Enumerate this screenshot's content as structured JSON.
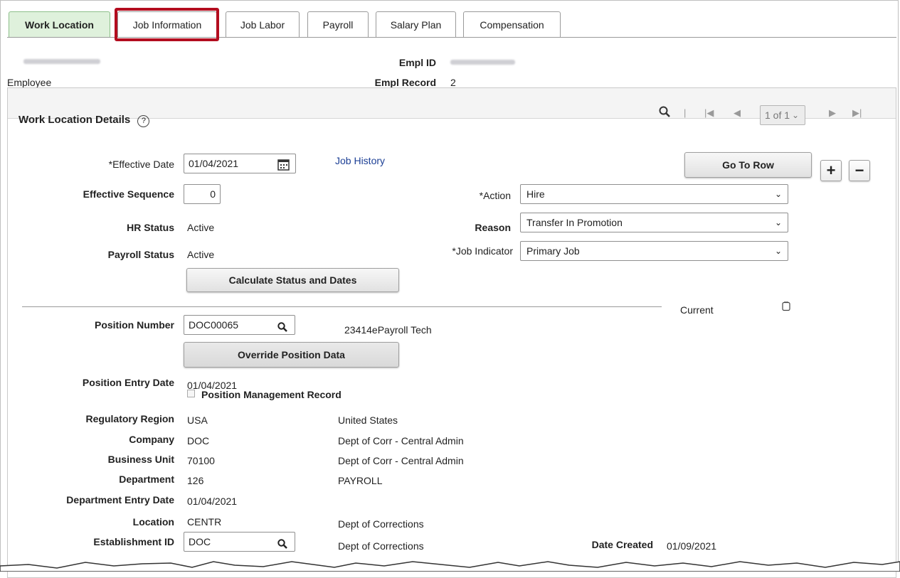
{
  "tabs": [
    {
      "label": "Work Location",
      "active": true
    },
    {
      "label": "Job Information",
      "active": false
    },
    {
      "label": "Job Labor",
      "active": false
    },
    {
      "label": "Payroll",
      "active": false
    },
    {
      "label": "Salary Plan",
      "active": false
    },
    {
      "label": "Compensation",
      "active": false
    }
  ],
  "header": {
    "employee_label": "Employee",
    "empl_id_label": "Empl ID",
    "empl_record_label": "Empl Record",
    "empl_record_value": "2"
  },
  "section": {
    "title": "Work Location Details",
    "pager": "1 of 1"
  },
  "form": {
    "effective_date_label": "*Effective Date",
    "effective_date": "01/04/2021",
    "job_history_link": "Job History",
    "go_to_row": "Go To Row",
    "effective_sequence_label": "Effective Sequence",
    "effective_sequence": "0",
    "action_label": "*Action",
    "action_value": "Hire",
    "hr_status_label": "HR Status",
    "hr_status": "Active",
    "reason_label": "Reason",
    "reason_value": "Transfer In Promotion",
    "payroll_status_label": "Payroll Status",
    "payroll_status": "Active",
    "job_indicator_label": "*Job Indicator",
    "job_indicator_value": "Primary Job",
    "calc_button": "Calculate Status and Dates",
    "current_label": "Current",
    "position_number_label": "Position Number",
    "position_number": "DOC00065",
    "position_desc": "23414ePayroll Tech",
    "override_button": "Override Position Data",
    "position_entry_date_label": "Position Entry Date",
    "position_entry_date": "01/04/2021",
    "position_mgmt_label": "Position Management Record",
    "regulatory_region_label": "Regulatory Region",
    "regulatory_region": "USA",
    "regulatory_region_desc": "United States",
    "company_label": "Company",
    "company": "DOC",
    "company_desc": "Dept of Corr - Central Admin",
    "business_unit_label": "Business Unit",
    "business_unit": "70100",
    "business_unit_desc": "Dept of Corr - Central Admin",
    "department_label": "Department",
    "department": "126",
    "department_desc": "PAYROLL",
    "dept_entry_date_label": "Department Entry Date",
    "dept_entry_date": "01/04/2021",
    "location_label": "Location",
    "location": "CENTR",
    "location_desc": "Dept of Corrections",
    "establishment_label": "Establishment ID",
    "establishment": "DOC",
    "establishment_desc": "Dept of Corrections",
    "date_created_label": "Date Created",
    "date_created": "01/09/2021"
  },
  "colors": {
    "accent_box": "#b30d1f",
    "active_tab": "#dff1dc",
    "link": "#1c3f95"
  }
}
